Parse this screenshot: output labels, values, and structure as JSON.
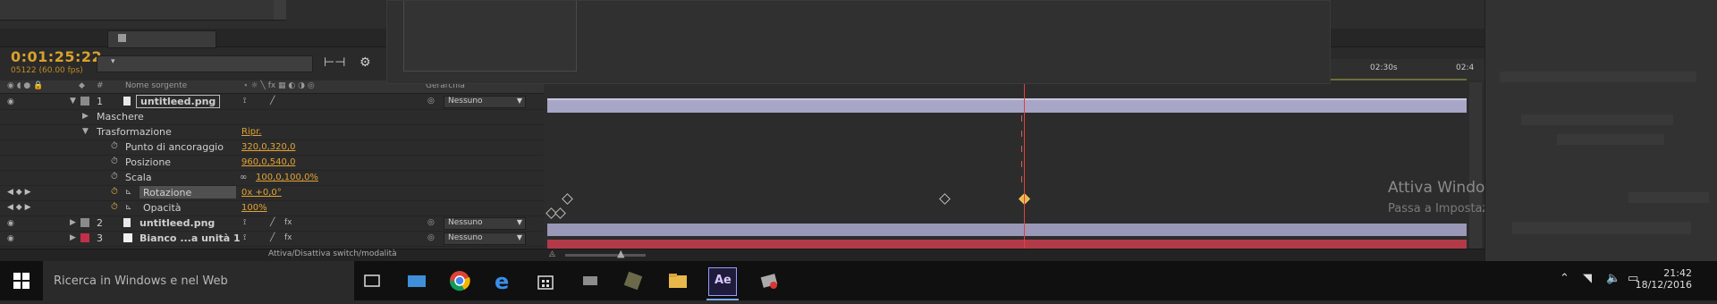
{
  "timecode": "0:01:25:22",
  "frames_label": "05122 (60.00 fps)",
  "columns": {
    "source_name": "Nome sorgente",
    "number": "#",
    "parent": "Gerarchia"
  },
  "layers": [
    {
      "number": "1",
      "name": "untitleed.png",
      "parent": "Nessuno",
      "label_color": "#8a8a8a"
    },
    {
      "number": "2",
      "name": "untitleed.png",
      "parent": "Nessuno",
      "label_color": "#8a8a8a"
    },
    {
      "number": "3",
      "name": "Bianco ...a unità 1",
      "parent": "Nessuno",
      "label_color": "#c0304a"
    }
  ],
  "properties": {
    "masks": "Maschere",
    "transform": "Trasformazione",
    "reset": "Ripr.",
    "anchor_label": "Punto di ancoraggio",
    "anchor_value": "320,0,320,0",
    "position_label": "Posizione",
    "position_value": "960,0,540,0",
    "scale_label": "Scala",
    "scale_value": "100,0,100,0%",
    "rotation_label": "Rotazione",
    "rotation_value": "0x +0,0°",
    "opacity_label": "Opacità",
    "opacity_value": "100%"
  },
  "ruler": {
    "tick_a": "02:30s",
    "tick_b": "02:4"
  },
  "toggle_text": "Attiva/Disattiva switch/modalità",
  "watermark": {
    "title": "Attiva Windows",
    "subtitle": "Passa a Impostazioni per attivare Windows."
  },
  "taskbar": {
    "search_placeholder": "Ricerca in Windows e nel Web",
    "time": "21:42",
    "date": "18/12/2016",
    "ae_label": "Ae"
  },
  "colors": {
    "timecode": "#d8a22b",
    "layer_bar": "#a8a6c6",
    "solid_bar": "#b23a48",
    "playhead": "#e04040"
  }
}
